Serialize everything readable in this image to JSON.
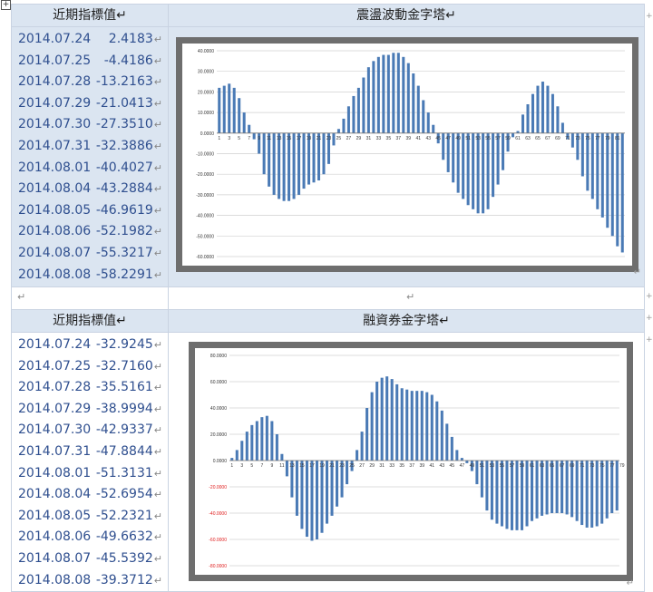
{
  "markers": {
    "para": "↵",
    "cross": "+",
    "handle": "+"
  },
  "table1": {
    "left_header": "近期指標值",
    "right_header": "震盪波動金字塔",
    "rows": [
      {
        "date": "2014.07.24",
        "value": "2.4183"
      },
      {
        "date": "2014.07.25",
        "value": "-4.4186"
      },
      {
        "date": "2014.07.28",
        "value": "-13.2163"
      },
      {
        "date": "2014.07.29",
        "value": "-21.0413"
      },
      {
        "date": "2014.07.30",
        "value": "-27.3510"
      },
      {
        "date": "2014.07.31",
        "value": "-32.3886"
      },
      {
        "date": "2014.08.01",
        "value": "-40.4027"
      },
      {
        "date": "2014.08.04",
        "value": "-43.2884"
      },
      {
        "date": "2014.08.05",
        "value": "-46.9619"
      },
      {
        "date": "2014.08.06",
        "value": "-52.1982"
      },
      {
        "date": "2014.08.07",
        "value": "-55.3217"
      },
      {
        "date": "2014.08.08",
        "value": "-58.2291"
      }
    ]
  },
  "table2": {
    "left_header": "近期指標值",
    "right_header": "融資券金字塔",
    "rows": [
      {
        "date": "2014.07.24",
        "value": "-32.9245"
      },
      {
        "date": "2014.07.25",
        "value": "-32.7160"
      },
      {
        "date": "2014.07.28",
        "value": "-35.5161"
      },
      {
        "date": "2014.07.29",
        "value": "-38.9994"
      },
      {
        "date": "2014.07.30",
        "value": "-42.9337"
      },
      {
        "date": "2014.07.31",
        "value": "-47.8844"
      },
      {
        "date": "2014.08.01",
        "value": "-51.3131"
      },
      {
        "date": "2014.08.04",
        "value": "-52.6954"
      },
      {
        "date": "2014.08.05",
        "value": "-52.2321"
      },
      {
        "date": "2014.08.06",
        "value": "-49.6632"
      },
      {
        "date": "2014.08.07",
        "value": "-45.5392"
      },
      {
        "date": "2014.08.08",
        "value": "-39.3712"
      }
    ]
  },
  "chart_data": [
    {
      "type": "bar",
      "ylim": [
        -60,
        40
      ],
      "yticks": [
        40,
        30,
        20,
        10,
        0,
        -10,
        -20,
        -30,
        -40,
        -50,
        -60
      ],
      "ytick_labels": [
        "40.0000",
        "30.0000",
        "20.0000",
        "10.0000",
        "0.0000",
        "-10.0000",
        "-20.0000",
        "-30.0000",
        "-40.0000",
        "-50.0000",
        "-60.0000"
      ],
      "x_ticks": [
        "1",
        "3",
        "5",
        "7",
        "9",
        "11",
        "13",
        "15",
        "17",
        "19",
        "21",
        "23",
        "25",
        "27",
        "29",
        "31",
        "33",
        "35",
        "37",
        "39",
        "41",
        "43",
        "45",
        "47",
        "49",
        "51",
        "53",
        "55",
        "57",
        "59",
        "61",
        "63",
        "65",
        "67",
        "69",
        "71",
        "73",
        "75",
        "77",
        "79",
        "81"
      ],
      "bar_color": "#4a7ab5",
      "grid": true,
      "values": [
        22,
        23,
        24,
        22,
        17,
        10,
        4,
        -3,
        -10,
        -20,
        -26,
        -30,
        -32,
        -33,
        -33,
        -32,
        -30,
        -27,
        -25,
        -24,
        -23,
        -20,
        -15,
        -6,
        2,
        7,
        13,
        18,
        22,
        27,
        32,
        35,
        37,
        38,
        38,
        39,
        39,
        37,
        34,
        29,
        23,
        16,
        10,
        4,
        -5,
        -13,
        -19,
        -24,
        -29,
        -32,
        -35,
        -37,
        -39,
        -39,
        -37,
        -31,
        -25,
        -18,
        -9,
        -2,
        1,
        9,
        14,
        19,
        23,
        25,
        23,
        19,
        13,
        5,
        -3,
        -7,
        -13,
        -21,
        -28,
        -32,
        -37,
        -41,
        -46,
        -50,
        -55,
        -58
      ]
    },
    {
      "type": "bar",
      "ylim": [
        -80,
        80
      ],
      "yticks": [
        80,
        60,
        40,
        20,
        0,
        -20,
        -40,
        -60,
        -80
      ],
      "ytick_labels": [
        "80.0000",
        "60.0000",
        "40.0000",
        "20.0000",
        "0.0000",
        "-20.0000",
        "-40.0000",
        "-60.0000",
        "-80.0000"
      ],
      "x_ticks": [
        "1",
        "3",
        "5",
        "7",
        "9",
        "11",
        "13",
        "15",
        "17",
        "19",
        "21",
        "23",
        "25",
        "27",
        "29",
        "31",
        "33",
        "35",
        "37",
        "39",
        "41",
        "43",
        "45",
        "47",
        "49",
        "51",
        "53",
        "55",
        "57",
        "59",
        "61",
        "63",
        "65",
        "67",
        "69",
        "71",
        "73",
        "75",
        "77",
        "79",
        "81"
      ],
      "bar_color": "#4a7ab5",
      "negative_label_color": "#e02020",
      "grid": true,
      "values": [
        2,
        8,
        15,
        22,
        27,
        30,
        33,
        34,
        30,
        20,
        5,
        -12,
        -28,
        -42,
        -52,
        -58,
        -61,
        -60,
        -55,
        -48,
        -42,
        -35,
        -28,
        -18,
        -8,
        8,
        22,
        40,
        52,
        60,
        63,
        64,
        62,
        58,
        55,
        54,
        53,
        53,
        53,
        52,
        50,
        45,
        38,
        28,
        18,
        8,
        2,
        -2,
        -8,
        -18,
        -28,
        -38,
        -45,
        -48,
        -50,
        -52,
        -53,
        -53,
        -53,
        -50,
        -46,
        -44,
        -42,
        -41,
        -40,
        -40,
        -40,
        -41,
        -43,
        -46,
        -49,
        -51,
        -51,
        -50,
        -48,
        -44,
        -40,
        -38
      ]
    }
  ]
}
